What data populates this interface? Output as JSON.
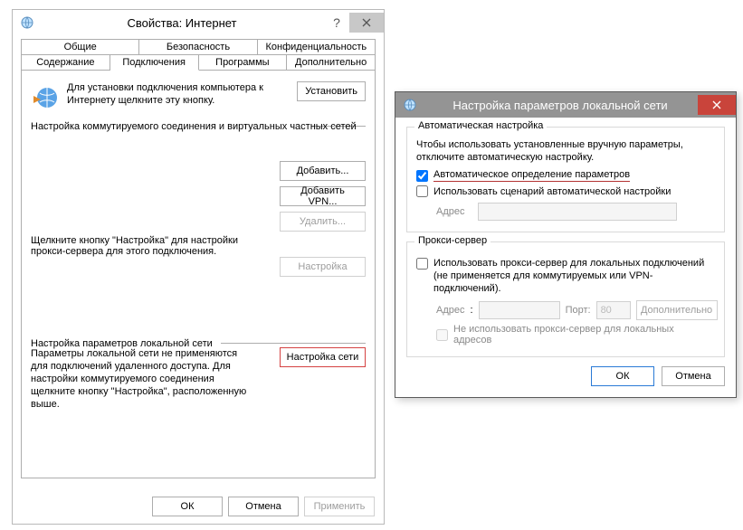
{
  "dlg1": {
    "title": "Свойства: Интернет",
    "tabs_row1": [
      "Общие",
      "Безопасность",
      "Конфиденциальность"
    ],
    "tabs_row2": [
      "Содержание",
      "Подключения",
      "Программы",
      "Дополнительно"
    ],
    "active_tab": "Подключения",
    "setup_text": "Для установки подключения компьютера к Интернету щелкните эту кнопку.",
    "setup_btn": "Установить",
    "dialup_label": "Настройка коммутируемого соединения и виртуальных частных сетей",
    "add_btn": "Добавить...",
    "add_vpn_btn": "Добавить VPN...",
    "remove_btn": "Удалить...",
    "proxy_hint": "Щелкните кнопку \"Настройка\" для настройки прокси-сервера для этого подключения.",
    "config_btn": "Настройка",
    "lan_label": "Настройка параметров локальной сети",
    "lan_text": "Параметры локальной сети не применяются для подключений удаленного доступа. Для настройки коммутируемого соединения щелкните кнопку \"Настройка\", расположенную выше.",
    "lan_btn": "Настройка сети",
    "ok": "ОК",
    "cancel": "Отмена",
    "apply": "Применить"
  },
  "dlg2": {
    "title": "Настройка параметров локальной сети",
    "group_auto": "Автоматическая настройка",
    "auto_text": "Чтобы использовать установленные вручную параметры, отключите автоматическую настройку.",
    "cb_auto": "Автоматическое определение параметров",
    "cb_auto_checked": true,
    "cb_script": "Использовать сценарий автоматической настройки",
    "cb_script_checked": false,
    "addr_label": "Адрес",
    "group_proxy": "Прокси-сервер",
    "cb_proxy": "Использовать прокси-сервер для локальных подключений (не применяется для коммутируемых или VPN-подключений).",
    "cb_proxy_checked": false,
    "port_label": "Порт:",
    "port_value": "80",
    "advanced_btn": "Дополнительно",
    "cb_bypass": "Не использовать прокси-сервер для локальных адресов",
    "cb_bypass_checked": false,
    "ok": "ОК",
    "cancel": "Отмена"
  }
}
